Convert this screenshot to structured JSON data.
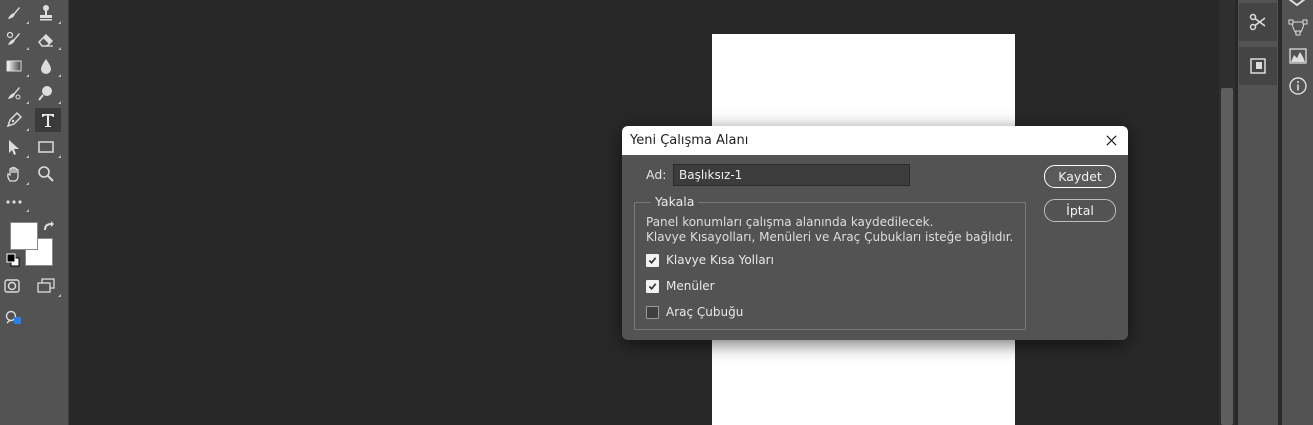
{
  "dialog": {
    "title": "Yeni Çalışma Alanı",
    "name_label": "Ad:",
    "name_value": "Başlıksız-1",
    "save_label": "Kaydet",
    "cancel_label": "İptal",
    "group_legend": "Yakala",
    "description_line1": "Panel konumları çalışma alanında kaydedilecek.",
    "description_line2": "Klavye Kısayolları, Menüleri ve Araç Çubukları isteğe bağlıdır.",
    "options": [
      {
        "label": "Klavye Kısa Yolları",
        "checked": true
      },
      {
        "label": "Menüler",
        "checked": true
      },
      {
        "label": "Araç Çubuğu",
        "checked": false
      }
    ]
  },
  "toolbar": {
    "tools": [
      "brush-tool",
      "clone-stamp-tool",
      "history-brush-tool",
      "eraser-tool",
      "gradient-tool",
      "blur-tool",
      "dodge-tool",
      "zoom-lens-tool",
      "pen-tool",
      "type-tool",
      "path-selection-tool",
      "rectangle-tool",
      "hand-tool",
      "zoom-tool",
      "more-tools"
    ],
    "active_tool": "type-tool",
    "foreground_color": "#ffffff",
    "background_color": "#ffffff"
  },
  "colors": {
    "app_background": "#282828",
    "panel": "#535353",
    "document": "#ffffff"
  }
}
